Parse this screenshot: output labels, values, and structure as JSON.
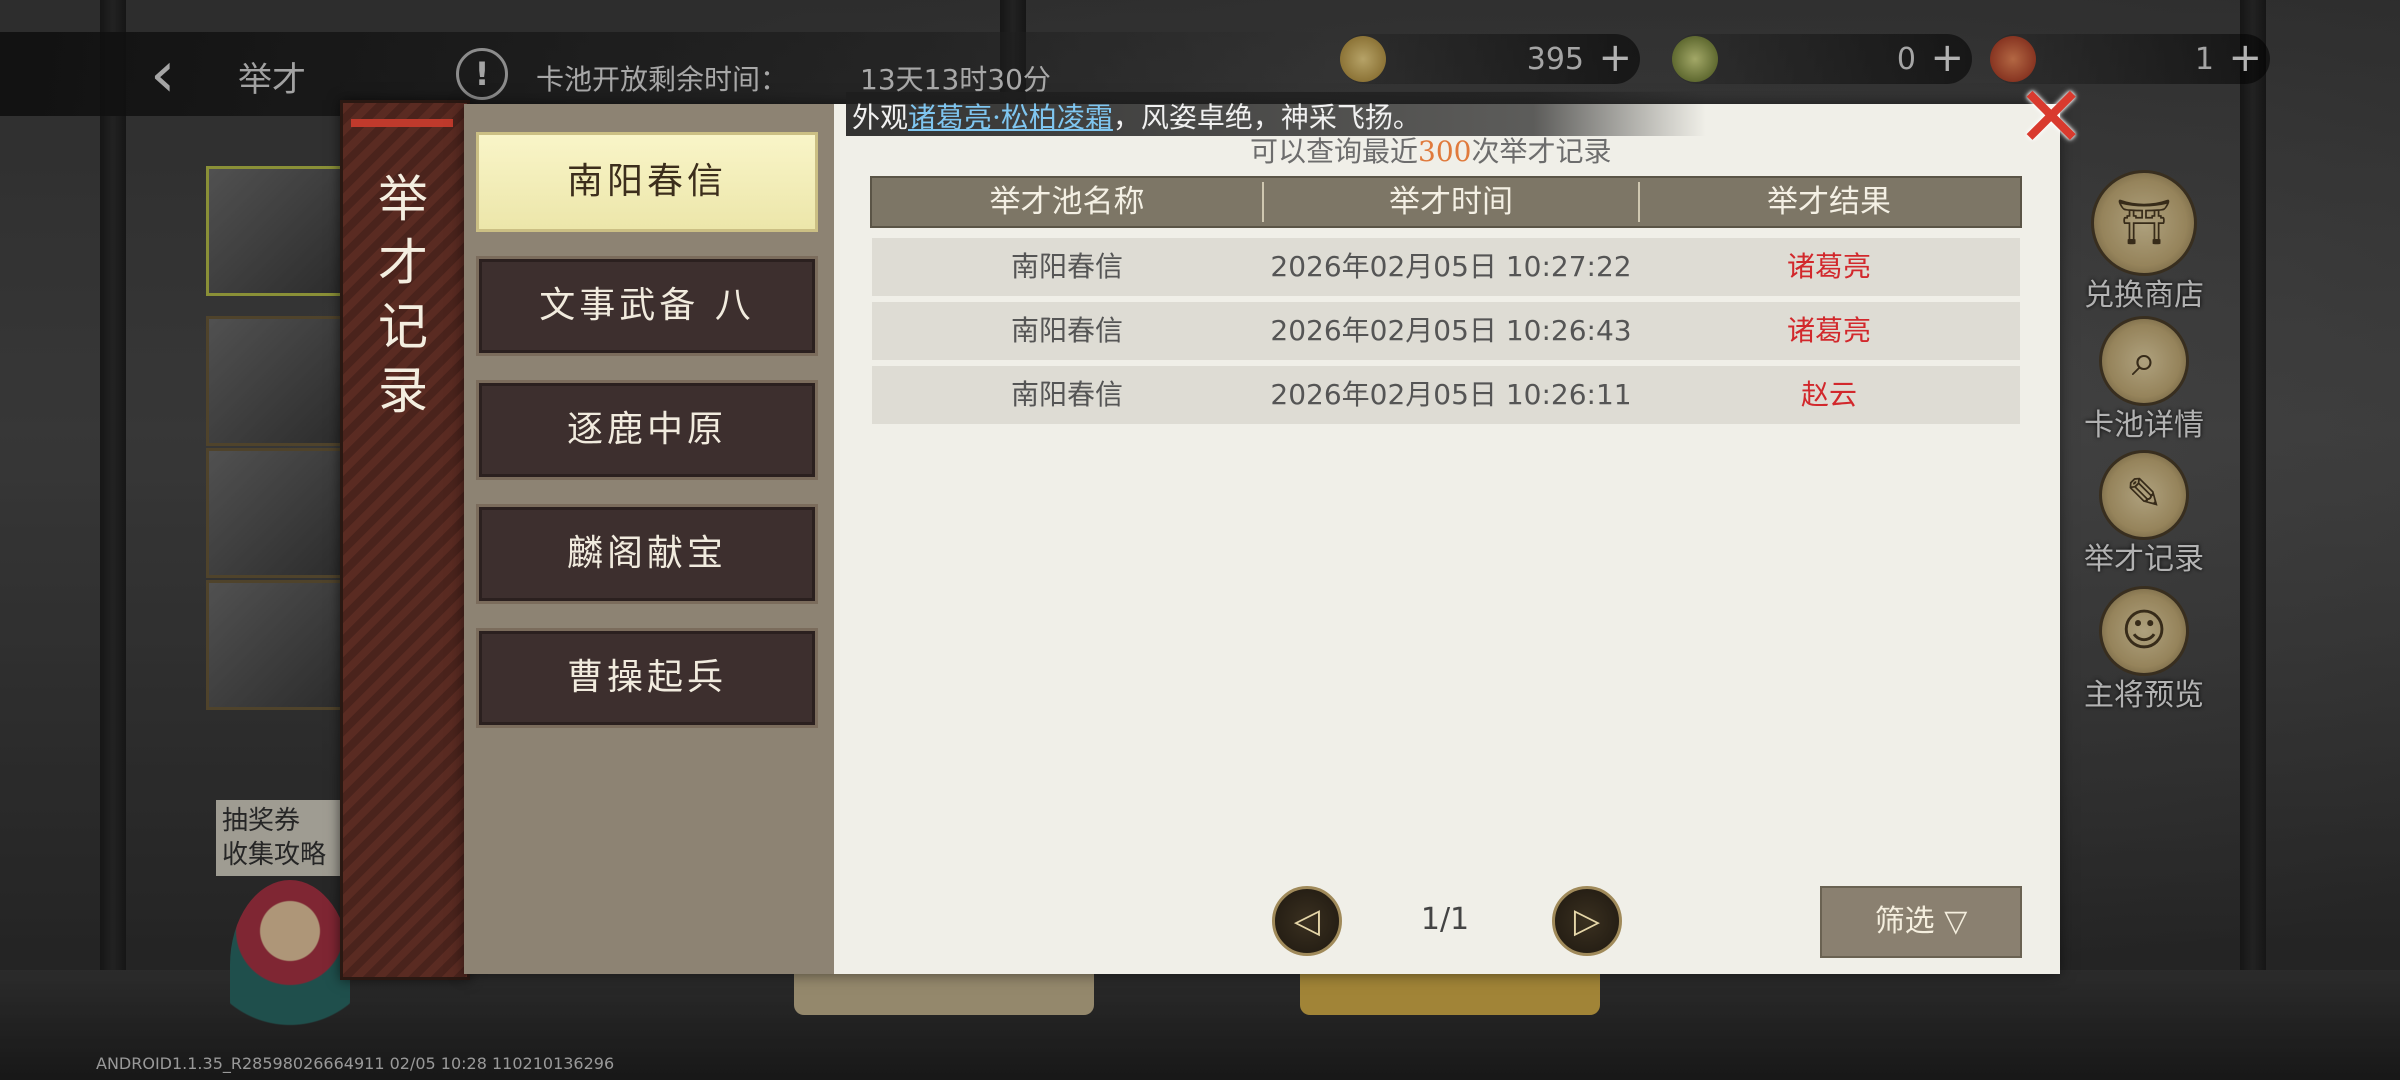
{
  "header": {
    "back_icon": "chevron-left-icon",
    "title": "举才",
    "timer_label": "卡池开放剩余时间：",
    "timer_value": "13天13时30分"
  },
  "currencies": [
    {
      "icon": "coin-icon",
      "value": "395",
      "color": "#c8a24a"
    },
    {
      "icon": "jade-icon",
      "value": "0",
      "color": "#7a8f40"
    },
    {
      "icon": "seal-icon",
      "value": "1",
      "color": "#c0392b"
    }
  ],
  "left": {
    "ticket_tag": "抽奖券\n收集攻略",
    "version": "ANDROID1.1.35_R28598026664911 02/05 10:28 110210136296"
  },
  "side_buttons": [
    {
      "label": "兑换商店",
      "icon": "shop-icon"
    },
    {
      "label": "卡池详情",
      "icon": "magnifier-icon"
    },
    {
      "label": "举才记录",
      "icon": "scroll-icon"
    },
    {
      "label": "主将预览",
      "icon": "general-preview-icon"
    }
  ],
  "modal": {
    "side_title": "举才记录",
    "marquee_prefix": "外观",
    "marquee_highlight": "诸葛亮·松柏凌霜",
    "marquee_suffix": "，风姿卓绝，神采飞扬。",
    "hint_prefix": "可以查询最近",
    "hint_number": "300",
    "hint_suffix": "次举才记录",
    "tabs": [
      {
        "label": "南阳春信",
        "active": true
      },
      {
        "label": "文事武备 八",
        "active": false
      },
      {
        "label": "逐鹿中原",
        "active": false
      },
      {
        "label": "麟阁献宝",
        "active": false
      },
      {
        "label": "曹操起兵",
        "active": false
      }
    ],
    "columns": [
      "举才池名称",
      "举才时间",
      "举才结果"
    ],
    "rows": [
      {
        "pool": "南阳春信",
        "time": "2026年02月05日 10:27:22",
        "result": "诸葛亮"
      },
      {
        "pool": "南阳春信",
        "time": "2026年02月05日 10:26:43",
        "result": "诸葛亮"
      },
      {
        "pool": "南阳春信",
        "time": "2026年02月05日 10:26:11",
        "result": "赵云"
      }
    ],
    "page_indicator": "1/1",
    "filter_label": "筛选"
  }
}
